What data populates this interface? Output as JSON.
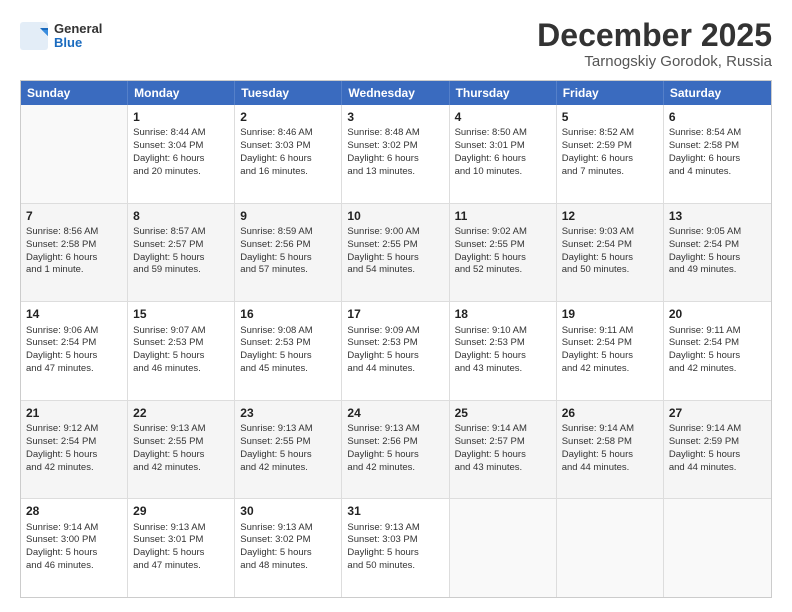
{
  "header": {
    "logo": {
      "general": "General",
      "blue": "Blue"
    },
    "title": "December 2025",
    "location": "Tarnogskiy Gorodok, Russia"
  },
  "days_of_week": [
    "Sunday",
    "Monday",
    "Tuesday",
    "Wednesday",
    "Thursday",
    "Friday",
    "Saturday"
  ],
  "weeks": [
    [
      {
        "day": "",
        "info": ""
      },
      {
        "day": "1",
        "info": "Sunrise: 8:44 AM\nSunset: 3:04 PM\nDaylight: 6 hours\nand 20 minutes."
      },
      {
        "day": "2",
        "info": "Sunrise: 8:46 AM\nSunset: 3:03 PM\nDaylight: 6 hours\nand 16 minutes."
      },
      {
        "day": "3",
        "info": "Sunrise: 8:48 AM\nSunset: 3:02 PM\nDaylight: 6 hours\nand 13 minutes."
      },
      {
        "day": "4",
        "info": "Sunrise: 8:50 AM\nSunset: 3:01 PM\nDaylight: 6 hours\nand 10 minutes."
      },
      {
        "day": "5",
        "info": "Sunrise: 8:52 AM\nSunset: 2:59 PM\nDaylight: 6 hours\nand 7 minutes."
      },
      {
        "day": "6",
        "info": "Sunrise: 8:54 AM\nSunset: 2:58 PM\nDaylight: 6 hours\nand 4 minutes."
      }
    ],
    [
      {
        "day": "7",
        "info": "Sunrise: 8:56 AM\nSunset: 2:58 PM\nDaylight: 6 hours\nand 1 minute."
      },
      {
        "day": "8",
        "info": "Sunrise: 8:57 AM\nSunset: 2:57 PM\nDaylight: 5 hours\nand 59 minutes."
      },
      {
        "day": "9",
        "info": "Sunrise: 8:59 AM\nSunset: 2:56 PM\nDaylight: 5 hours\nand 57 minutes."
      },
      {
        "day": "10",
        "info": "Sunrise: 9:00 AM\nSunset: 2:55 PM\nDaylight: 5 hours\nand 54 minutes."
      },
      {
        "day": "11",
        "info": "Sunrise: 9:02 AM\nSunset: 2:55 PM\nDaylight: 5 hours\nand 52 minutes."
      },
      {
        "day": "12",
        "info": "Sunrise: 9:03 AM\nSunset: 2:54 PM\nDaylight: 5 hours\nand 50 minutes."
      },
      {
        "day": "13",
        "info": "Sunrise: 9:05 AM\nSunset: 2:54 PM\nDaylight: 5 hours\nand 49 minutes."
      }
    ],
    [
      {
        "day": "14",
        "info": "Sunrise: 9:06 AM\nSunset: 2:54 PM\nDaylight: 5 hours\nand 47 minutes."
      },
      {
        "day": "15",
        "info": "Sunrise: 9:07 AM\nSunset: 2:53 PM\nDaylight: 5 hours\nand 46 minutes."
      },
      {
        "day": "16",
        "info": "Sunrise: 9:08 AM\nSunset: 2:53 PM\nDaylight: 5 hours\nand 45 minutes."
      },
      {
        "day": "17",
        "info": "Sunrise: 9:09 AM\nSunset: 2:53 PM\nDaylight: 5 hours\nand 44 minutes."
      },
      {
        "day": "18",
        "info": "Sunrise: 9:10 AM\nSunset: 2:53 PM\nDaylight: 5 hours\nand 43 minutes."
      },
      {
        "day": "19",
        "info": "Sunrise: 9:11 AM\nSunset: 2:54 PM\nDaylight: 5 hours\nand 42 minutes."
      },
      {
        "day": "20",
        "info": "Sunrise: 9:11 AM\nSunset: 2:54 PM\nDaylight: 5 hours\nand 42 minutes."
      }
    ],
    [
      {
        "day": "21",
        "info": "Sunrise: 9:12 AM\nSunset: 2:54 PM\nDaylight: 5 hours\nand 42 minutes."
      },
      {
        "day": "22",
        "info": "Sunrise: 9:13 AM\nSunset: 2:55 PM\nDaylight: 5 hours\nand 42 minutes."
      },
      {
        "day": "23",
        "info": "Sunrise: 9:13 AM\nSunset: 2:55 PM\nDaylight: 5 hours\nand 42 minutes."
      },
      {
        "day": "24",
        "info": "Sunrise: 9:13 AM\nSunset: 2:56 PM\nDaylight: 5 hours\nand 42 minutes."
      },
      {
        "day": "25",
        "info": "Sunrise: 9:14 AM\nSunset: 2:57 PM\nDaylight: 5 hours\nand 43 minutes."
      },
      {
        "day": "26",
        "info": "Sunrise: 9:14 AM\nSunset: 2:58 PM\nDaylight: 5 hours\nand 44 minutes."
      },
      {
        "day": "27",
        "info": "Sunrise: 9:14 AM\nSunset: 2:59 PM\nDaylight: 5 hours\nand 44 minutes."
      }
    ],
    [
      {
        "day": "28",
        "info": "Sunrise: 9:14 AM\nSunset: 3:00 PM\nDaylight: 5 hours\nand 46 minutes."
      },
      {
        "day": "29",
        "info": "Sunrise: 9:13 AM\nSunset: 3:01 PM\nDaylight: 5 hours\nand 47 minutes."
      },
      {
        "day": "30",
        "info": "Sunrise: 9:13 AM\nSunset: 3:02 PM\nDaylight: 5 hours\nand 48 minutes."
      },
      {
        "day": "31",
        "info": "Sunrise: 9:13 AM\nSunset: 3:03 PM\nDaylight: 5 hours\nand 50 minutes."
      },
      {
        "day": "",
        "info": ""
      },
      {
        "day": "",
        "info": ""
      },
      {
        "day": "",
        "info": ""
      }
    ]
  ]
}
